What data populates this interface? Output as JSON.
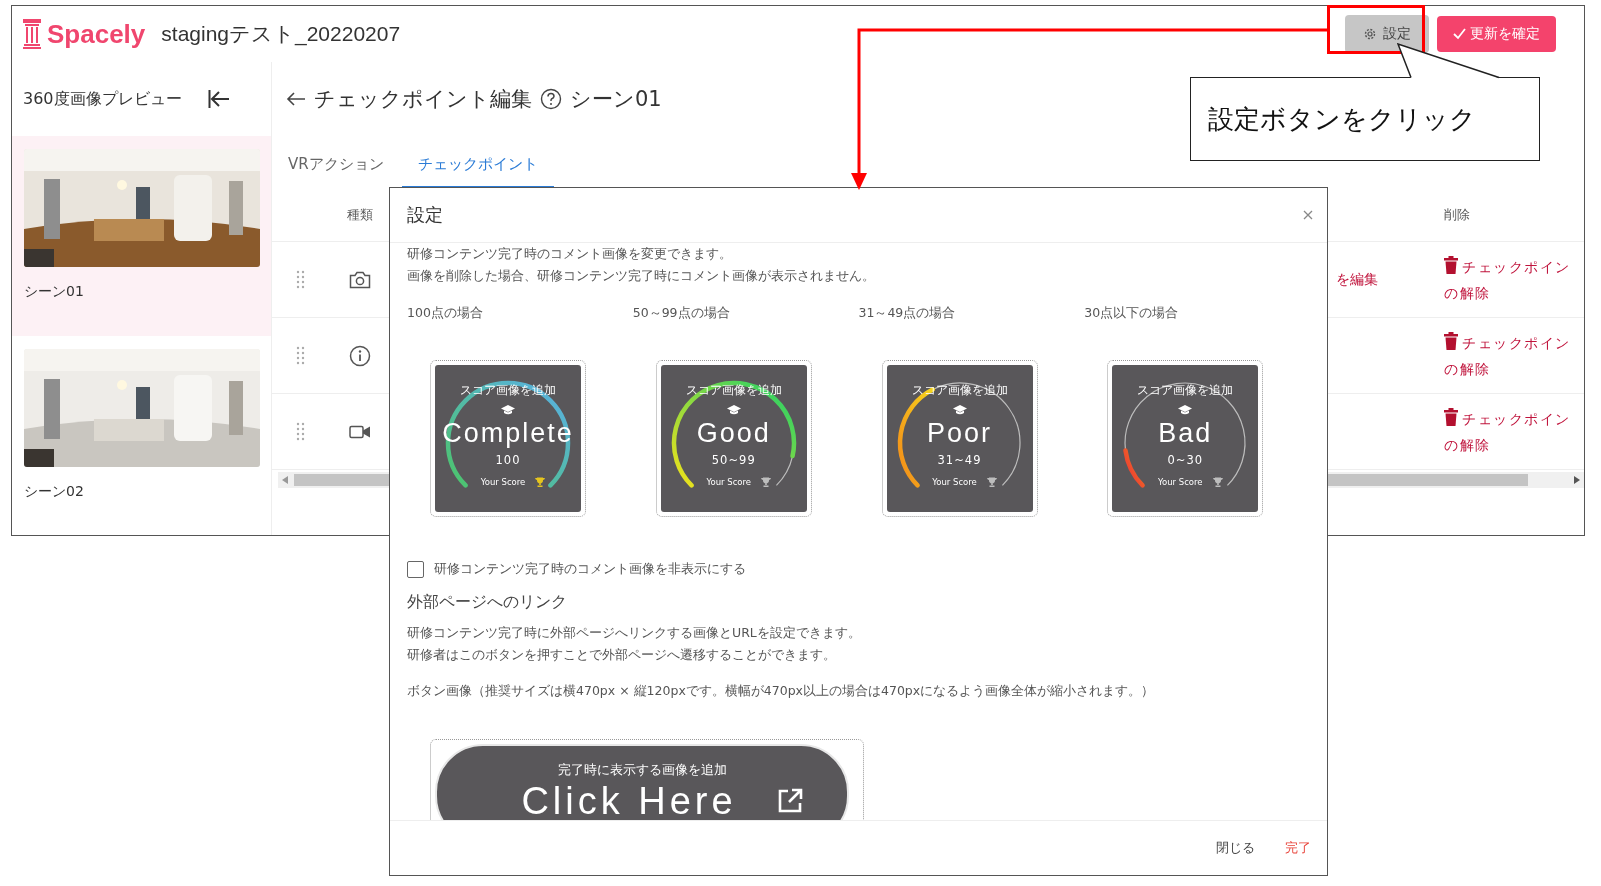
{
  "header": {
    "logo": "Spacely",
    "title": "stagingテスト_20220207",
    "settings_button": "設定",
    "confirm_button": "更新を確定"
  },
  "sidebar": {
    "title": "360度画像プレビュー",
    "scenes": [
      {
        "label": "シーン01",
        "selected": true
      },
      {
        "label": "シーン02",
        "selected": false
      }
    ]
  },
  "editor": {
    "title": "チェックポイント編集",
    "scene": "シーン01",
    "tabs": [
      {
        "label": "VRアクション",
        "selected": false
      },
      {
        "label": "チェックポイント",
        "selected": true
      }
    ],
    "columns": [
      "種類",
      "削除"
    ],
    "rows": [
      {
        "edit_link": "を編集",
        "delete_link": "チェックポインの解除"
      },
      {
        "kind": "info",
        "delete_link": "チェックポインの解除"
      },
      {
        "kind": "video",
        "delete_link": "チェックポインの解除"
      }
    ]
  },
  "modal": {
    "title": "設定",
    "intro": [
      "研修コンテンツ完了時のコメント画像を変更できます。",
      "画像を削除した場合、研修コンテンツ完了時にコメント画像が表示されません。"
    ],
    "scores": [
      {
        "label": "100点の場合",
        "prompt": "スコア画像を追加",
        "word": "Complete",
        "range": "100",
        "caption": "Your Score",
        "kind": "complete",
        "trophy_lit": true
      },
      {
        "label": "50～99点の場合",
        "prompt": "スコア画像を追加",
        "word": "Good",
        "range": "50~99",
        "caption": "Your Score",
        "kind": "good",
        "trophy_lit": false
      },
      {
        "label": "31～49点の場合",
        "prompt": "スコア画像を追加",
        "word": "Poor",
        "range": "31~49",
        "caption": "Your Score",
        "kind": "poor",
        "trophy_lit": false
      },
      {
        "label": "30点以下の場合",
        "prompt": "スコア画像を追加",
        "word": "Bad",
        "range": "0~30",
        "caption": "Your Score",
        "kind": "bad",
        "trophy_lit": false
      }
    ],
    "hide_checkbox": {
      "label": "研修コンテンツ完了時のコメント画像を非表示にする",
      "checked": false
    },
    "link_heading": "外部ページへのリンク",
    "link_text": [
      "研修コンテンツ完了時に外部ページへリンクする画像とURLを設定できます。",
      "研修者はこのボタンを押すことで外部ページへ遷移することができます。"
    ],
    "button_image_note": "ボタン画像（推奨サイズは横470px × 縦120pxです。横幅が470px以上の場合は470pxになるよう画像全体が縮小されます。）",
    "button_image": {
      "prompt": "完了時に表示する画像を追加",
      "word": "Click Here"
    },
    "footer": {
      "close": "閉じる",
      "done": "完了"
    }
  },
  "callout": {
    "text": "設定ボタンをクリック"
  }
}
